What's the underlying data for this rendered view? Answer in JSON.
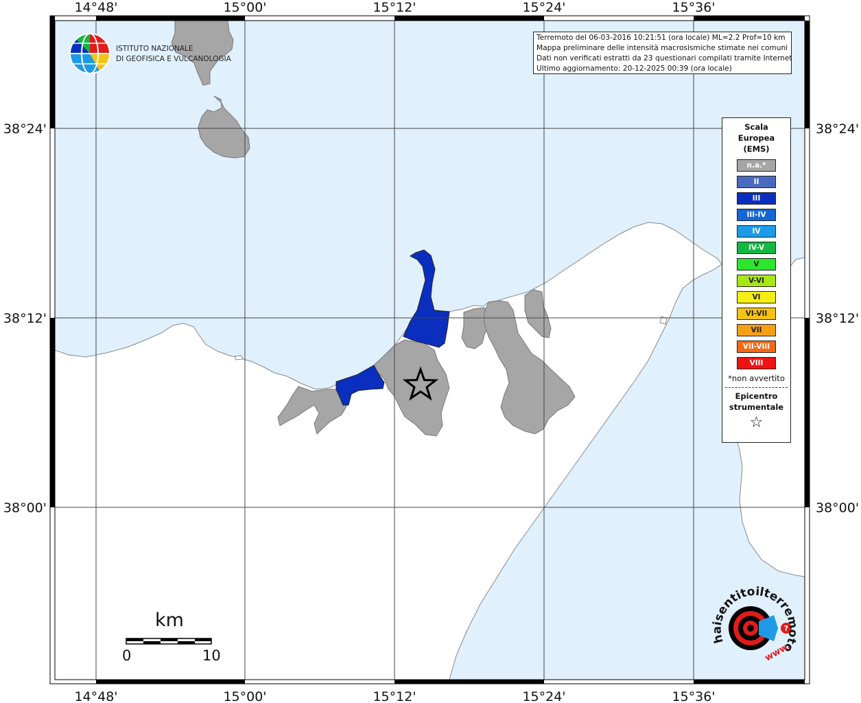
{
  "map": {
    "lon_ticks": [
      "14°48'",
      "15°00'",
      "15°12'",
      "15°24'",
      "15°36'"
    ],
    "lat_ticks": [
      "38°24'",
      "38°12'",
      "38°00'"
    ],
    "colors": {
      "sea": "#e0f0fc",
      "land": "#ffffff",
      "municipality_na": "#a6a6a6",
      "intensity_iii": "#0a2fbf",
      "frame": "#000000"
    }
  },
  "institute": {
    "name_line1": "ISTITUTO NAZIONALE",
    "name_line2": "DI GEOFISICA E VULCANOLOGIA"
  },
  "info": {
    "line1": "Terremoto del 06-03-2016 10:21:51 (ora locale) ML=2.2 Prof=10 km",
    "line2": "Mappa preliminare delle intensità macrosismiche stimate nei comuni",
    "line3": "Dati non verificati estratti da 23 questionari compilati tramite Internet.",
    "line4": "Ultimo aggiornamento: 20-12-2025 00:39 (ora locale)"
  },
  "legend": {
    "title_line1": "Scala",
    "title_line2": "Europea",
    "title_line3": "(EMS)",
    "items": [
      {
        "label": "n.a.*",
        "color": "#a6a6a6"
      },
      {
        "label": "II",
        "color": "#4a6bbd"
      },
      {
        "label": "III",
        "color": "#0a2fbf"
      },
      {
        "label": "III-IV",
        "color": "#1466d6"
      },
      {
        "label": "IV",
        "color": "#1e9be6"
      },
      {
        "label": "IV-V",
        "color": "#12b842"
      },
      {
        "label": "V",
        "color": "#2be62b"
      },
      {
        "label": "V-VI",
        "color": "#a8e614"
      },
      {
        "label": "VI",
        "color": "#f5ee14"
      },
      {
        "label": "VI-VII",
        "color": "#f5c314"
      },
      {
        "label": "VII",
        "color": "#f5a014"
      },
      {
        "label": "VII-VIII",
        "color": "#f56914"
      },
      {
        "label": "VIII",
        "color": "#ee1414"
      }
    ],
    "note": "*non avvertito",
    "epicenter_line1": "Epicentro",
    "epicenter_line2": "strumentale"
  },
  "scale_bar": {
    "unit": "km",
    "start_label": "0",
    "end_label": "10"
  },
  "footer_logo": {
    "text": "haisentitoilterremoto.it",
    "prefix": "www."
  }
}
